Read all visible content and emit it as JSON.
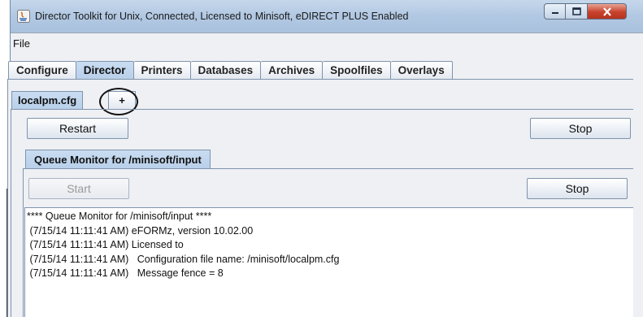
{
  "window": {
    "title": "Director Toolkit for Unix, Connected, Licensed to Minisoft, eDIRECT PLUS Enabled"
  },
  "menu": {
    "items": [
      "File"
    ]
  },
  "tabs": {
    "items": [
      "Configure",
      "Director",
      "Printers",
      "Databases",
      "Archives",
      "Spoolfiles",
      "Overlays"
    ],
    "active": "Director"
  },
  "config_tabs": {
    "current": "localpm.cfg",
    "add": "+"
  },
  "director": {
    "restart_label": "Restart",
    "stop_label": "Stop"
  },
  "queue_monitor": {
    "tab_label": "Queue Monitor for /minisoft/input",
    "start_label": "Start",
    "stop_label": "Stop",
    "log": [
      "**** Queue Monitor for /minisoft/input ****",
      " (7/15/14 11:11:41 AM) eFORMz, version 10.02.00",
      " (7/15/14 11:11:41 AM) Licensed to",
      " (7/15/14 11:11:41 AM)   Configuration file name: /minisoft/localpm.cfg",
      " (7/15/14 11:11:41 AM)   Message fence = 8"
    ]
  },
  "colors": {
    "active_tab": "#c9dcf1",
    "close_button": "#c7412b"
  }
}
